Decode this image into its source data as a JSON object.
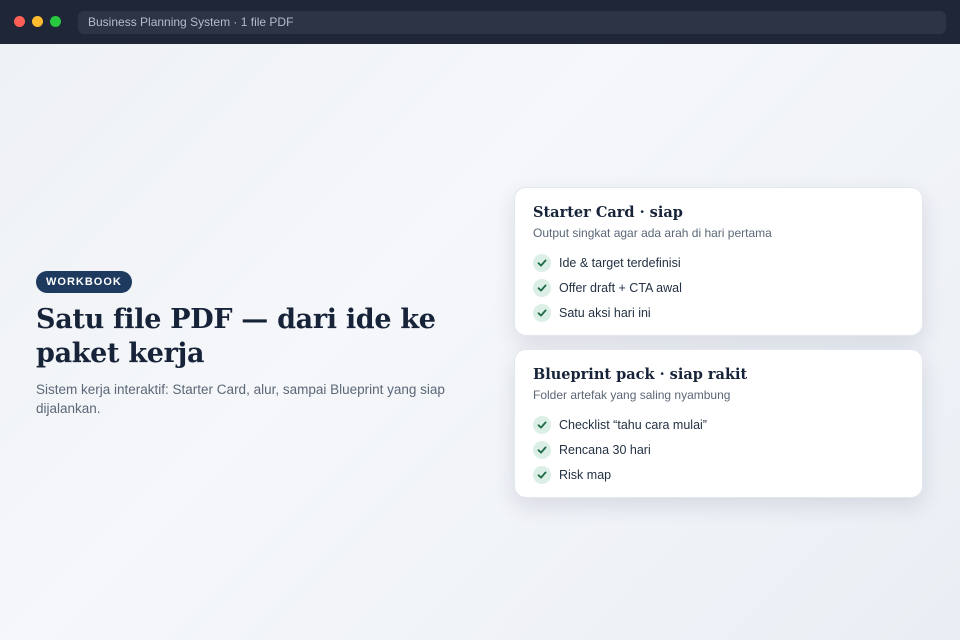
{
  "window": {
    "address": "Business Planning System · 1 file PDF"
  },
  "hero": {
    "badge": "WORKBOOK",
    "title": "Satu file PDF — dari ide ke paket kerja",
    "description": "Sistem kerja interaktif: Starter Card, alur, sampai Blueprint yang siap dijalankan."
  },
  "cards": [
    {
      "title": "Starter Card · siap",
      "subtitle": "Output singkat agar ada arah di hari pertama",
      "items": [
        "Ide & target terdefinisi",
        "Offer draft + CTA awal",
        "Satu aksi hari ini"
      ]
    },
    {
      "title": "Blueprint pack · siap rakit",
      "subtitle": "Folder artefak yang saling nyambung",
      "items": [
        "Checklist “tahu cara mulai”",
        "Rencana 30 hari",
        "Risk map"
      ]
    }
  ],
  "colors": {
    "badge_bg": "#1e3a5f",
    "check_bg": "#dcefe6",
    "check_mark": "#1f6b47"
  },
  "icons": {
    "item": "check-icon"
  }
}
